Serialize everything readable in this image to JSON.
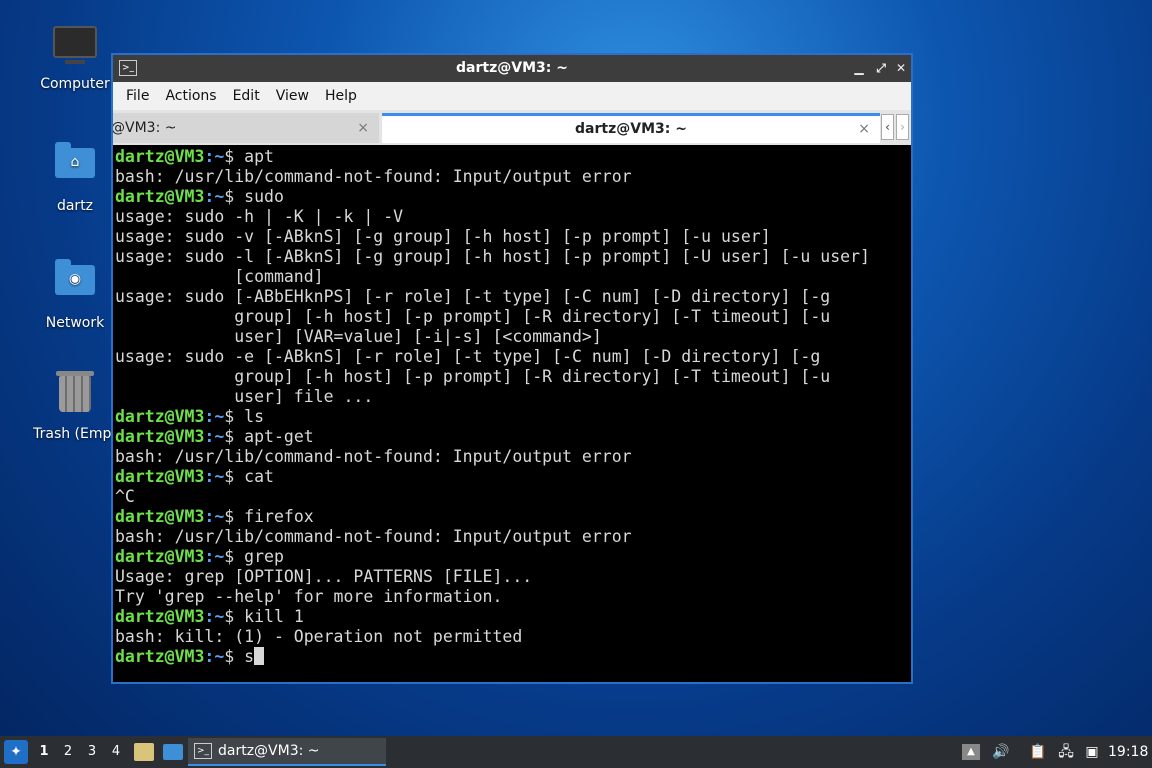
{
  "desktop": {
    "icons": [
      {
        "label": "Computer"
      },
      {
        "label": "dartz"
      },
      {
        "label": "Network"
      },
      {
        "label": "Trash (Empt"
      }
    ]
  },
  "window": {
    "title": "dartz@VM3: ~",
    "menu": [
      "File",
      "Actions",
      "Edit",
      "View",
      "Help"
    ],
    "tabs": [
      {
        "label": "@VM3: ~",
        "active": false
      },
      {
        "label": "dartz@VM3: ~",
        "active": true
      }
    ],
    "close_glyph": "×"
  },
  "terminal": {
    "prompt_user": "dartz@VM3",
    "prompt_path": ":~",
    "prompt_sign": "$ ",
    "lines": [
      {
        "type": "prompt",
        "cmd": "apt"
      },
      {
        "type": "out",
        "text": "bash: /usr/lib/command-not-found: Input/output error"
      },
      {
        "type": "prompt",
        "cmd": "sudo"
      },
      {
        "type": "out",
        "text": "usage: sudo -h | -K | -k | -V"
      },
      {
        "type": "out",
        "text": "usage: sudo -v [-ABknS] [-g group] [-h host] [-p prompt] [-u user]"
      },
      {
        "type": "out",
        "text": "usage: sudo -l [-ABknS] [-g group] [-h host] [-p prompt] [-U user] [-u user]"
      },
      {
        "type": "out",
        "text": "            [command]"
      },
      {
        "type": "out",
        "text": "usage: sudo [-ABbEHknPS] [-r role] [-t type] [-C num] [-D directory] [-g"
      },
      {
        "type": "out",
        "text": "            group] [-h host] [-p prompt] [-R directory] [-T timeout] [-u"
      },
      {
        "type": "out",
        "text": "            user] [VAR=value] [-i|-s] [<command>]"
      },
      {
        "type": "out",
        "text": "usage: sudo -e [-ABknS] [-r role] [-t type] [-C num] [-D directory] [-g"
      },
      {
        "type": "out",
        "text": "            group] [-h host] [-p prompt] [-R directory] [-T timeout] [-u"
      },
      {
        "type": "out",
        "text": "            user] file ..."
      },
      {
        "type": "prompt",
        "cmd": "ls"
      },
      {
        "type": "prompt",
        "cmd": "apt-get"
      },
      {
        "type": "out",
        "text": "bash: /usr/lib/command-not-found: Input/output error"
      },
      {
        "type": "prompt",
        "cmd": "cat"
      },
      {
        "type": "out",
        "text": "^C"
      },
      {
        "type": "prompt",
        "cmd": "firefox"
      },
      {
        "type": "out",
        "text": "bash: /usr/lib/command-not-found: Input/output error"
      },
      {
        "type": "prompt",
        "cmd": "grep"
      },
      {
        "type": "out",
        "text": "Usage: grep [OPTION]... PATTERNS [FILE]..."
      },
      {
        "type": "out",
        "text": "Try 'grep --help' for more information."
      },
      {
        "type": "prompt",
        "cmd": "kill 1"
      },
      {
        "type": "out",
        "text": "bash: kill: (1) - Operation not permitted"
      },
      {
        "type": "prompt",
        "cmd": "s",
        "cursor": true
      }
    ]
  },
  "taskbar": {
    "workspaces": [
      "1",
      "2",
      "3",
      "4"
    ],
    "task_label": "dartz@VM3: ~",
    "clock": "19:18"
  },
  "colors": {
    "prompt_user": "#6ee04a",
    "prompt_path": "#5b9df0",
    "accent": "#3a8ee6"
  }
}
